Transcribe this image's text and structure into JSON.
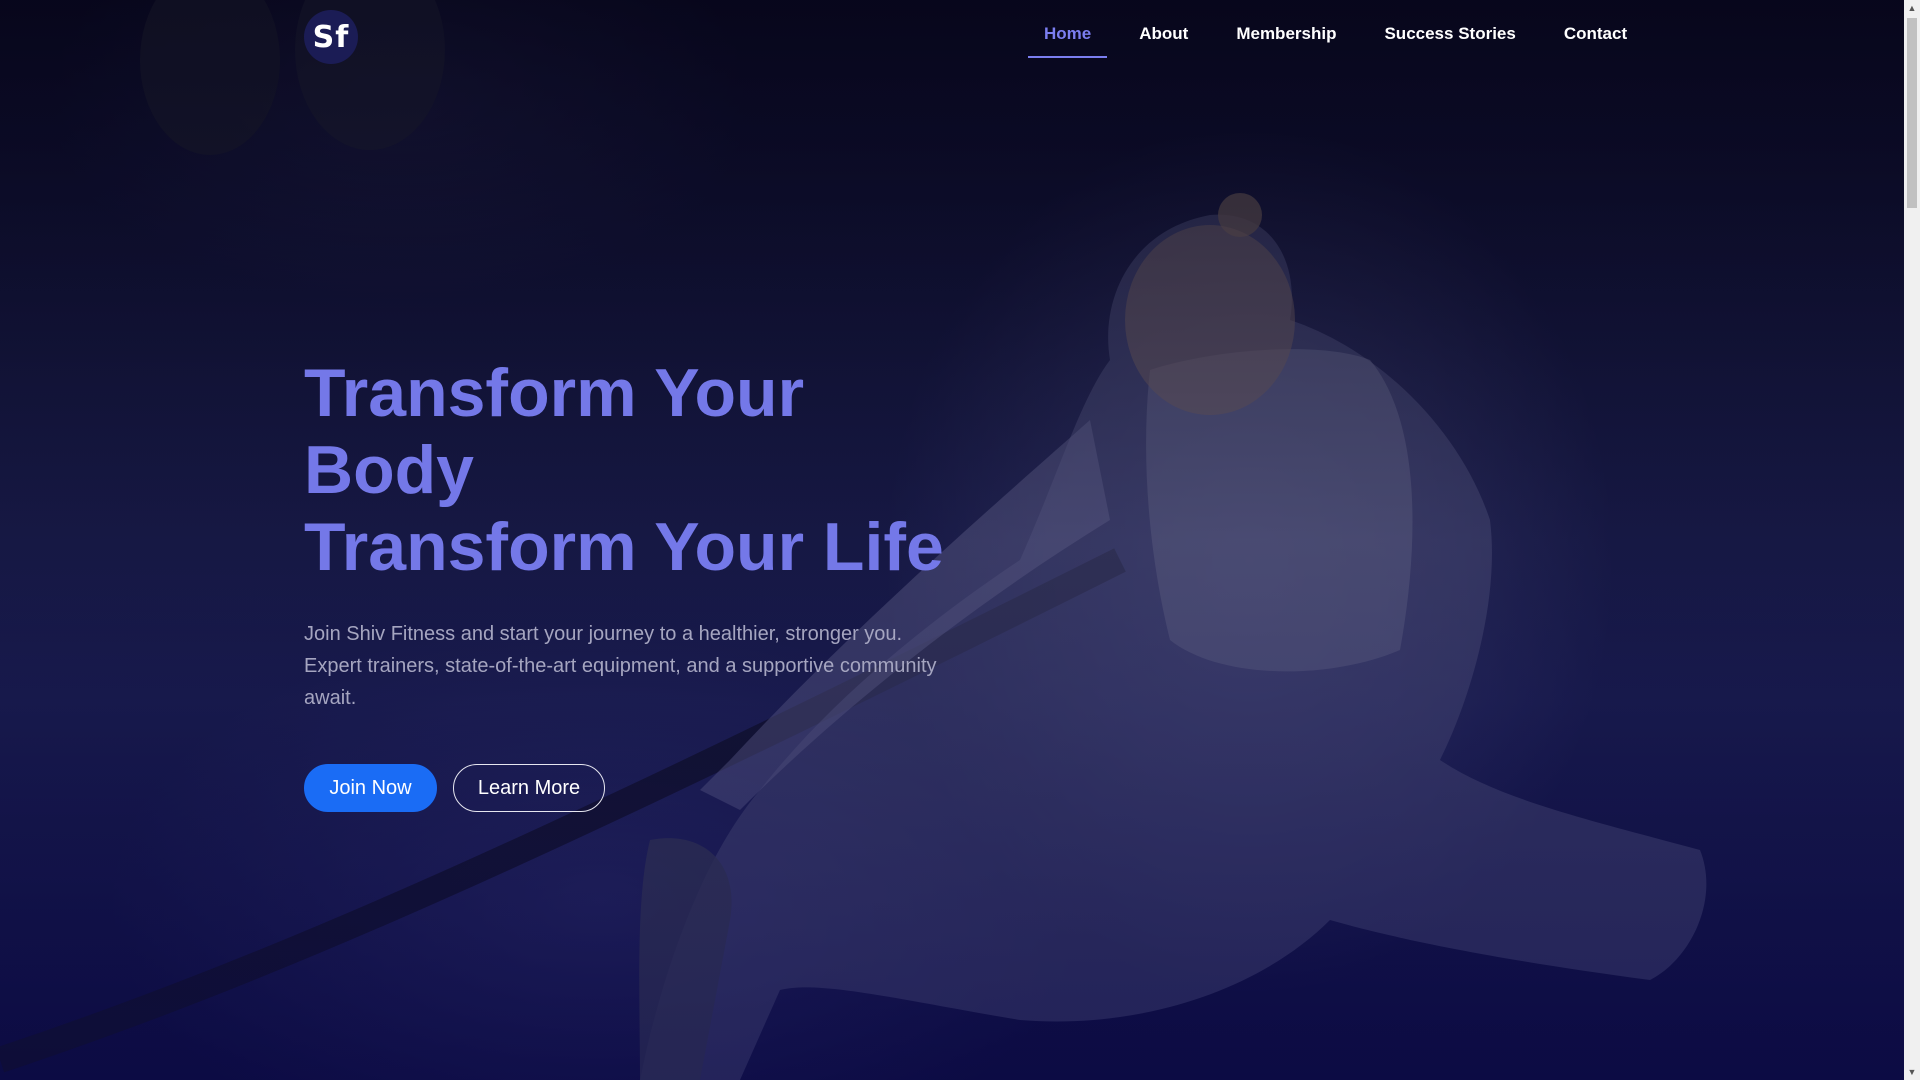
{
  "brand": {
    "logo_text": "Sf"
  },
  "nav": {
    "items": [
      {
        "label": "Home",
        "active": true
      },
      {
        "label": "About",
        "active": false
      },
      {
        "label": "Membership",
        "active": false
      },
      {
        "label": "Success Stories",
        "active": false
      },
      {
        "label": "Contact",
        "active": false
      }
    ]
  },
  "hero": {
    "title_line1": "Transform Your Body",
    "title_line2": "Transform Your Life",
    "subtitle": "Join Shiv Fitness and start your journey to a healthier, stronger you. Expert trainers, state-of-the-art equipment, and a supportive community await.",
    "primary_button": "Join Now",
    "secondary_button": "Learn More"
  },
  "colors": {
    "accent": "#7478e8",
    "primary_button": "#1a6cf5",
    "background": "#07061c"
  }
}
